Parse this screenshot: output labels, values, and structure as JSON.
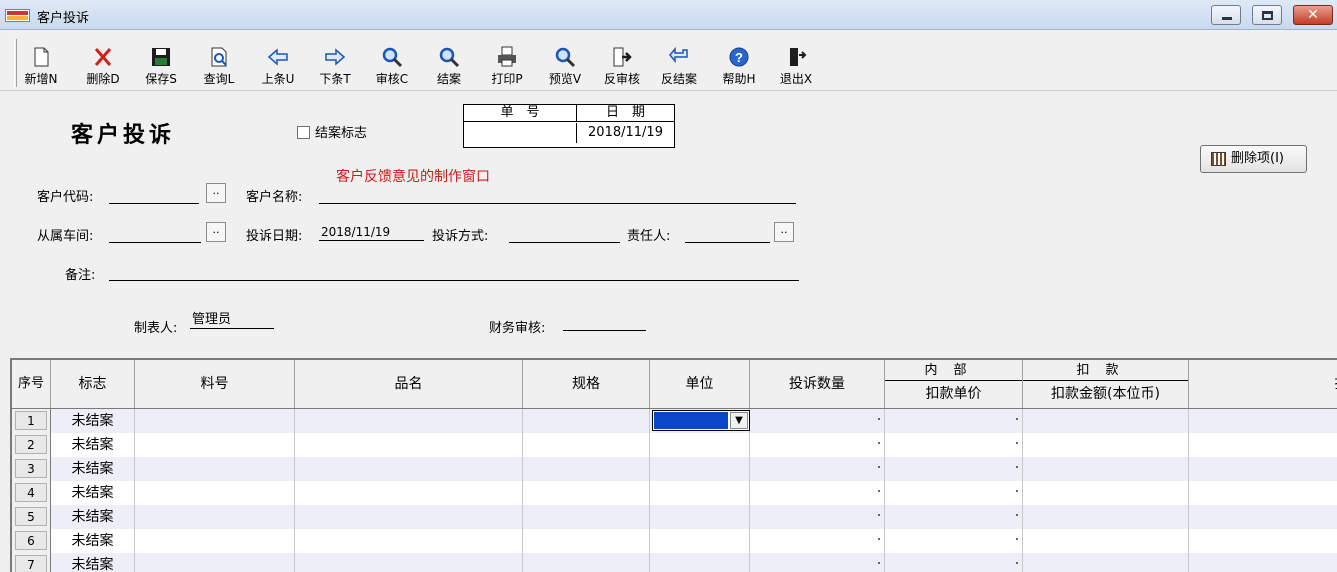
{
  "window": {
    "title": "客户投诉"
  },
  "toolbar": {
    "new": "新增N",
    "delete": "删除D",
    "save": "保存S",
    "query": "查询L",
    "prev": "上条U",
    "next": "下条T",
    "audit": "审核C",
    "close_case": "结案",
    "print": "打印P",
    "preview": "预览V",
    "unaudit": "反审核",
    "unclose": "反结案",
    "help": "帮助H",
    "exit": "退出X"
  },
  "form": {
    "title": "客户投诉",
    "close_flag_label": "结案标志",
    "no_header": "单　号",
    "date_header": "日　期",
    "no_value": "",
    "date_value": "2018/11/19",
    "note": "客户反馈意见的制作窗口",
    "delete_item_button": "删除项(I)",
    "customer_code_label": "客户代码:",
    "customer_name_label": "客户名称:",
    "workshop_label": "从属车间:",
    "complaint_date_label": "投诉日期:",
    "complaint_date_value": "2018/11/19",
    "complaint_method_label": "投诉方式:",
    "responsible_label": "责任人:",
    "remark_label": "备注:",
    "maker_label": "制表人:",
    "maker_value": "管理员",
    "finance_audit_label": "财务审核:",
    "dots": ".."
  },
  "grid": {
    "headers": {
      "seq": "序号",
      "flag": "标志",
      "material_no": "料号",
      "product_name": "品名",
      "spec": "规格",
      "unit": "单位",
      "complaint_qty": "投诉数量",
      "internal_top": "内部",
      "internal_bottom": "扣款单价",
      "deduction_top": "扣款",
      "deduction_bottom": "扣款金额(本位币)",
      "last_partial": "扌"
    },
    "rows": [
      {
        "num": "1",
        "flag": "未结案"
      },
      {
        "num": "2",
        "flag": "未结案"
      },
      {
        "num": "3",
        "flag": "未结案"
      },
      {
        "num": "4",
        "flag": "未结案"
      },
      {
        "num": "5",
        "flag": "未结案"
      },
      {
        "num": "6",
        "flag": "未结案"
      },
      {
        "num": "7",
        "flag": "未结案"
      }
    ]
  }
}
